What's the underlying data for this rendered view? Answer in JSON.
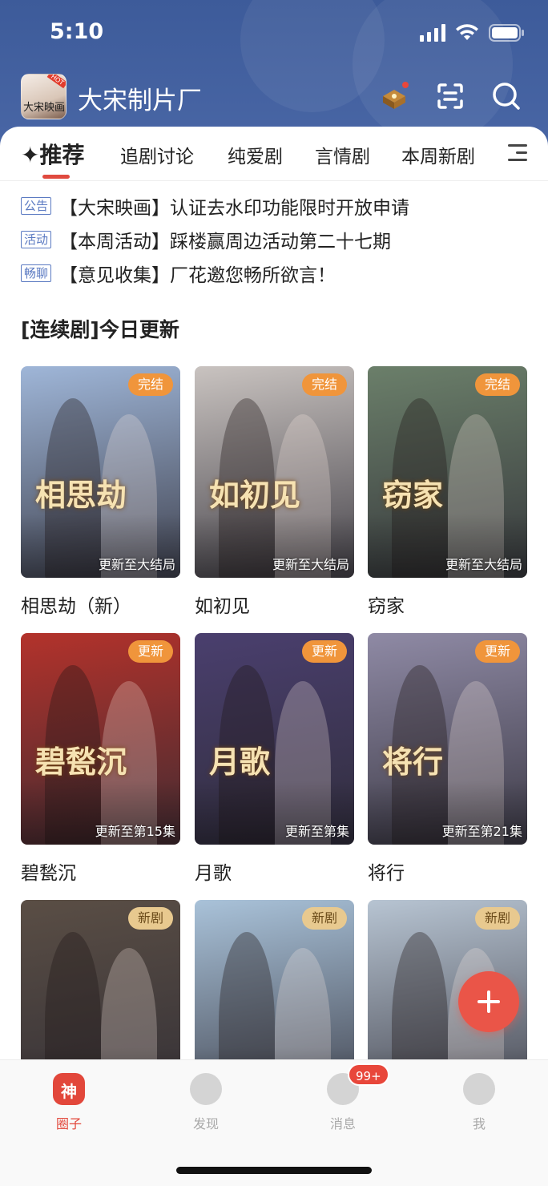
{
  "status_bar": {
    "time": "5:10"
  },
  "header": {
    "app_name": "大宋制片厂",
    "logo_badge": "HOT",
    "logo_text": "大宋映画"
  },
  "tabs": [
    {
      "label": "✦推荐",
      "active": true
    },
    {
      "label": "追剧讨论"
    },
    {
      "label": "纯爱剧"
    },
    {
      "label": "言情剧"
    },
    {
      "label": "本周新剧"
    }
  ],
  "notices": [
    {
      "tag": "公告",
      "text": "【大宋映画】认证去水印功能限时开放申请"
    },
    {
      "tag": "活动",
      "text": "【本周活动】踩楼赢周边活动第二十七期"
    },
    {
      "tag": "畅聊",
      "text": "【意见收集】厂花邀您畅所欲言！"
    }
  ],
  "section_title": "[连续剧]今日更新",
  "dramas": [
    {
      "title": "相思劫（新）",
      "badge": "完结",
      "progress": "更新至大结局",
      "calligraphy": "相思劫",
      "tone": "#9fb6d8"
    },
    {
      "title": "如初见",
      "badge": "完结",
      "progress": "更新至大结局",
      "calligraphy": "如初见",
      "tone": "#c9c3c0"
    },
    {
      "title": "窃家",
      "badge": "完结",
      "progress": "更新至大结局",
      "calligraphy": "窃家",
      "tone": "#6b7f6a"
    },
    {
      "title": "碧甃沉",
      "badge": "更新",
      "progress": "更新至第15集",
      "calligraphy": "碧甃沉",
      "tone": "#b3322b"
    },
    {
      "title": "月歌",
      "badge": "更新",
      "progress": "更新至第集",
      "calligraphy": "月歌",
      "tone": "#4a3f6e"
    },
    {
      "title": "将行",
      "badge": "更新",
      "progress": "更新至第21集",
      "calligraphy": "将行",
      "tone": "#8f8aa5"
    },
    {
      "title": "",
      "badge": "新剧",
      "progress": "",
      "calligraphy": "",
      "tone": "#5a4e45"
    },
    {
      "title": "",
      "badge": "新剧",
      "progress": "",
      "calligraphy": "",
      "tone": "#a9c2d9"
    },
    {
      "title": "",
      "badge": "新剧",
      "progress": "",
      "calligraphy": "",
      "tone": "#b7c4d2"
    }
  ],
  "bottom_nav": [
    {
      "label": "圈子",
      "icon": "circle-god-icon",
      "glyph": "神",
      "active": true
    },
    {
      "label": "发现",
      "icon": "planet-icon"
    },
    {
      "label": "消息",
      "icon": "chat-icon",
      "badge": "99+"
    },
    {
      "label": "我",
      "icon": "profile-mask-icon"
    }
  ],
  "colors": {
    "header_bg": "#3d5b9a",
    "accent_red": "#e2473b",
    "badge_orange": "#f0953b",
    "badge_new": "#e8c98f",
    "notice_tag": "#5b7ac2"
  }
}
